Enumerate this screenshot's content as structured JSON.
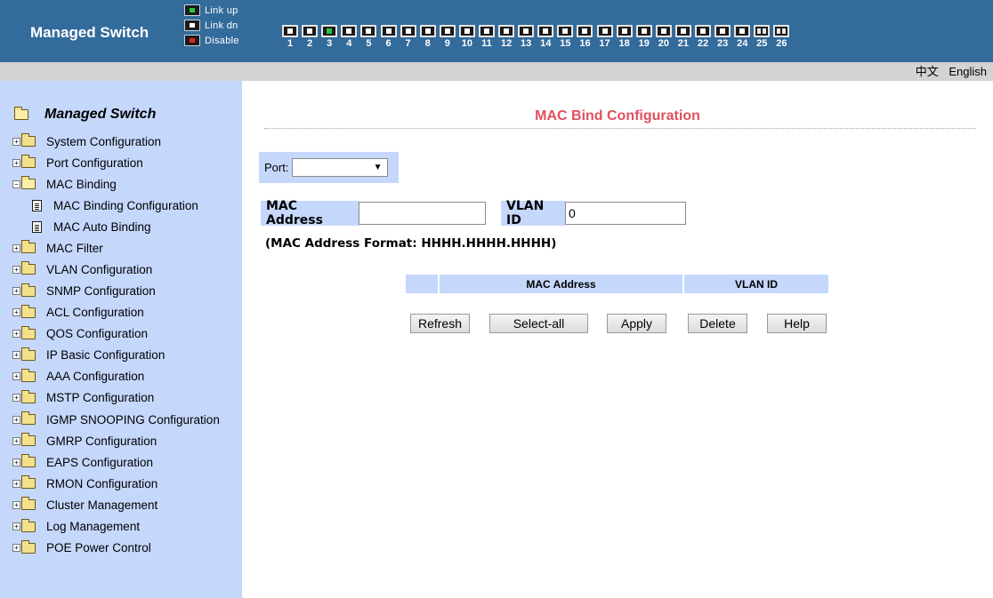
{
  "header": {
    "title": "Managed Switch",
    "legend": [
      {
        "label": "Link up",
        "state": "up"
      },
      {
        "label": "Link dn",
        "state": "dn"
      },
      {
        "label": "Disable",
        "state": "dis"
      }
    ],
    "ports": [
      {
        "num": "1",
        "state": "dn"
      },
      {
        "num": "2",
        "state": "dn"
      },
      {
        "num": "3",
        "state": "up"
      },
      {
        "num": "4",
        "state": "dn"
      },
      {
        "num": "5",
        "state": "dn"
      },
      {
        "num": "6",
        "state": "dn"
      },
      {
        "num": "7",
        "state": "dn"
      },
      {
        "num": "8",
        "state": "dn"
      },
      {
        "num": "9",
        "state": "dn"
      },
      {
        "num": "10",
        "state": "dn"
      },
      {
        "num": "11",
        "state": "dn"
      },
      {
        "num": "12",
        "state": "dn"
      },
      {
        "num": "13",
        "state": "dn"
      },
      {
        "num": "14",
        "state": "dn"
      },
      {
        "num": "15",
        "state": "dn"
      },
      {
        "num": "16",
        "state": "dn"
      },
      {
        "num": "17",
        "state": "dn"
      },
      {
        "num": "18",
        "state": "dn"
      },
      {
        "num": "19",
        "state": "dn"
      },
      {
        "num": "20",
        "state": "dn"
      },
      {
        "num": "21",
        "state": "dn"
      },
      {
        "num": "22",
        "state": "dn"
      },
      {
        "num": "23",
        "state": "dn"
      },
      {
        "num": "24",
        "state": "dn"
      },
      {
        "num": "25",
        "state": "fiber"
      },
      {
        "num": "26",
        "state": "fiber"
      }
    ]
  },
  "lang": {
    "chinese": "中文",
    "english": "English"
  },
  "sidebar": {
    "root": "Managed Switch",
    "items": [
      {
        "label": "System Configuration"
      },
      {
        "label": "Port Configuration"
      },
      {
        "label": "MAC Binding",
        "open": true,
        "children": [
          "MAC Binding Configuration",
          "MAC Auto Binding"
        ]
      },
      {
        "label": "MAC Filter"
      },
      {
        "label": "VLAN Configuration"
      },
      {
        "label": "SNMP Configuration"
      },
      {
        "label": "ACL Configuration"
      },
      {
        "label": "QOS Configuration"
      },
      {
        "label": "IP Basic Configuration"
      },
      {
        "label": "AAA Configuration"
      },
      {
        "label": "MSTP Configuration"
      },
      {
        "label": "IGMP SNOOPING Configuration"
      },
      {
        "label": "GMRP Configuration"
      },
      {
        "label": "EAPS Configuration"
      },
      {
        "label": "RMON Configuration"
      },
      {
        "label": "Cluster Management"
      },
      {
        "label": "Log Management"
      },
      {
        "label": "POE Power Control"
      }
    ]
  },
  "main": {
    "title": "MAC Bind Configuration",
    "port_label": "Port:",
    "port_value": "",
    "mac_label": "MAC Address",
    "mac_value": "",
    "vlan_label": "VLAN ID",
    "vlan_value": "0",
    "hint": "(MAC Address Format: HHHH.HHHH.HHHH)",
    "table_headers": [
      "",
      "MAC Address",
      "VLAN ID"
    ],
    "buttons": {
      "refresh": "Refresh",
      "select_all": "Select-all",
      "apply": "Apply",
      "delete": "Delete",
      "help": "Help"
    }
  },
  "colors": {
    "header_bg": "#336b9b",
    "sidebar_bg": "#c5d8fc",
    "title_color": "#e0505e"
  }
}
